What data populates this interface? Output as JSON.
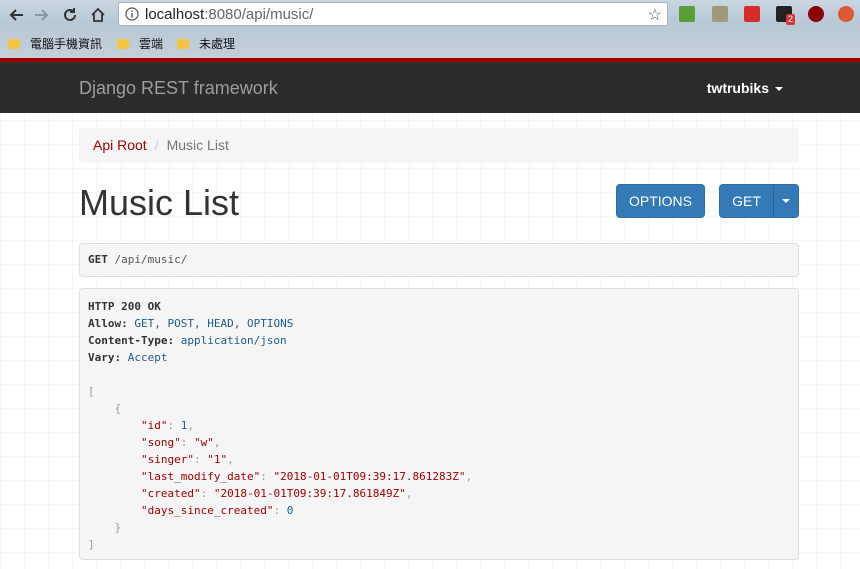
{
  "browser": {
    "url_host": "localhost",
    "url_rest": ":8080/api/music/",
    "bookmarks": [
      "電腦手機資訊",
      "雲端",
      "未處理"
    ],
    "extension_badge": "2"
  },
  "navbar": {
    "brand": "Django REST framework",
    "user": "twtrubiks"
  },
  "breadcrumb": {
    "root": "Api Root",
    "current": "Music List"
  },
  "page": {
    "title": "Music List",
    "options_label": "OPTIONS",
    "get_label": "GET"
  },
  "request": {
    "method": "GET",
    "path": "/api/music/"
  },
  "response": {
    "status": "HTTP 200 OK",
    "allow_label": "Allow:",
    "allow_value": "GET, POST, HEAD, OPTIONS",
    "content_type_label": "Content-Type:",
    "content_type_value": "application/json",
    "vary_label": "Vary:",
    "vary_value": "Accept",
    "body": {
      "id": {
        "key": "\"id\"",
        "value": "1"
      },
      "song": {
        "key": "\"song\"",
        "value": "\"w\""
      },
      "singer": {
        "key": "\"singer\"",
        "value": "\"1\""
      },
      "last_modify_date": {
        "key": "\"last_modify_date\"",
        "value": "\"2018-01-01T09:39:17.861283Z\""
      },
      "created": {
        "key": "\"created\"",
        "value": "\"2018-01-01T09:39:17.861849Z\""
      },
      "days_since_created": {
        "key": "\"days_since_created\"",
        "value": "0"
      }
    }
  },
  "colors": {
    "accent": "#a30000",
    "navbar_bg": "#2c2c2c",
    "button_bg": "#337ab7"
  }
}
